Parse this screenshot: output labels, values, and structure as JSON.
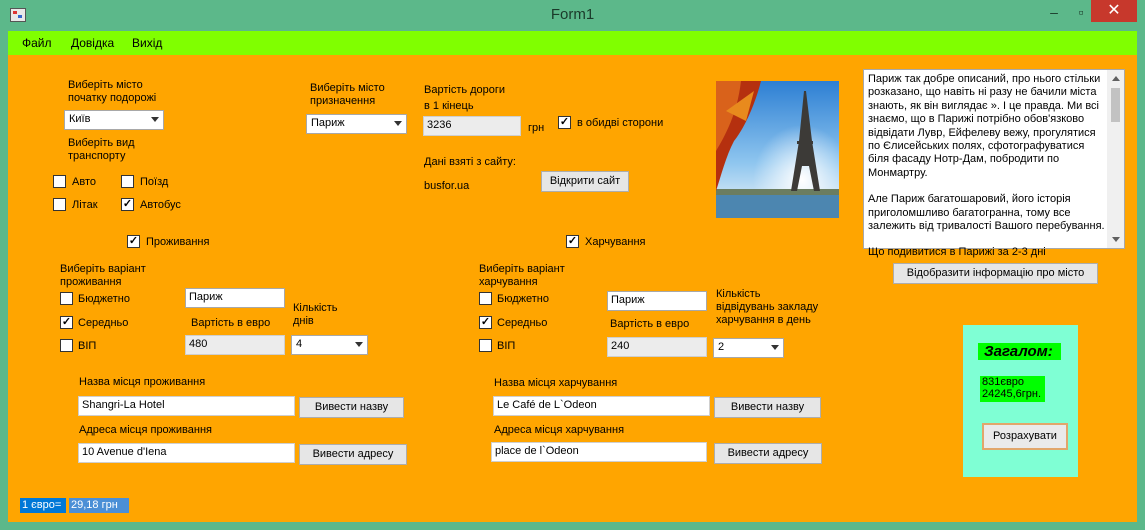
{
  "window": {
    "title": "Form1",
    "minimize_glyph": "–",
    "maximize_glyph": "▫",
    "close_glyph": "✕"
  },
  "menu": {
    "items": [
      "Файл",
      "Довідка",
      "Вихід"
    ]
  },
  "start": {
    "label_line1": "Виберіть місто",
    "label_line2": "початку подорожі",
    "city": "Київ"
  },
  "transport": {
    "label_line1": "Виберіть вид",
    "label_line2": "транспорту",
    "options": [
      {
        "label": "Авто",
        "checked": false
      },
      {
        "label": "Поїзд",
        "checked": false
      },
      {
        "label": "Літак",
        "checked": false
      },
      {
        "label": "Автобус",
        "checked": true
      }
    ]
  },
  "destination": {
    "label_line1": "Виберіть місто",
    "label_line2": "призначення",
    "city": "Париж"
  },
  "road": {
    "label_line1": "Вартість дороги",
    "label_line2": "в 1 кінець",
    "cost": "3236",
    "currency": "грн",
    "both_ways_label": "в обидві сторони",
    "both_ways_checked": true,
    "source_label": "Дані взяті з сайту:",
    "source_site": "busfor.ua",
    "open_site_button": "Відкрити сайт"
  },
  "city_info": {
    "paragraph1": "Париж так добре описаний, про нього стільки розказано, що навіть ні разу не бачили міста знають, як він виглядає ». І це правда. Ми всі знаємо, що в Парижі потрібно обов'язково відвідати Лувр, Ейфелеву вежу, прогулятися по Єлисейських полях, сфотографуватися біля фасаду Нотр-Дам, побродити по Монмартру.",
    "paragraph2": "Але Париж багатошаровий, його історія приголомшливо багатогранна, тому все залежить від тривалості Вашого перебування.",
    "paragraph3": "Що подивитися в Парижі за 2-3 дні",
    "show_button": "Відобразити інформацію про місто"
  },
  "accommodation": {
    "toggle_label": "Проживання",
    "toggle_checked": true,
    "variant_label_line1": "Виберіть варіант",
    "variant_label_line2": "проживання",
    "options": [
      {
        "label": "Бюджетно",
        "checked": false
      },
      {
        "label": "Середньо",
        "checked": true
      },
      {
        "label": "ВІП",
        "checked": false
      }
    ],
    "city": "Париж",
    "cost_label": "Вартість в евро",
    "cost": "480",
    "days_label_line1": "Кількість",
    "days_label_line2": "днів",
    "days": "4",
    "name_label": "Назва місця проживання",
    "name": "Shangri-La Hotel",
    "name_button": "Вивести назву",
    "address_label": "Адреса місця проживання",
    "address": "10 Avenue d'Iena",
    "address_button": "Вивести адресу"
  },
  "food": {
    "toggle_label": "Харчування",
    "toggle_checked": true,
    "variant_label_line1": "Виберіть варіант",
    "variant_label_line2": "харчування",
    "options": [
      {
        "label": "Бюджетно",
        "checked": false
      },
      {
        "label": "Середньо",
        "checked": true
      },
      {
        "label": "ВІП",
        "checked": false
      }
    ],
    "city": "Париж",
    "cost_label": "Вартість в евро",
    "cost": "240",
    "visits_label_line1": "Кількість",
    "visits_label_line2": "відвідувань закладу",
    "visits_label_line3": "харчування в день",
    "visits": "2",
    "name_label": "Назва місця харчування",
    "name": "Le Café de L`Odeon",
    "name_button": "Вивести назву",
    "address_label": "Адреса місця харчування",
    "address": "place de l`Odeon",
    "address_button": "Вивести адресу"
  },
  "total": {
    "title": "Загалом:",
    "euro": "831євро",
    "uah": "24245,6грн.",
    "calc_button": "Розрахувати"
  },
  "rate": {
    "label": "1 євро=",
    "value": "29,18  грн"
  },
  "colors": {
    "window_frame": "#5cb88a",
    "menubar": "#80ff00",
    "content": "#ffa500",
    "total_panel": "#7fffd4",
    "highlight_green": "#00ff00",
    "rate_blue": "#0078d7"
  }
}
